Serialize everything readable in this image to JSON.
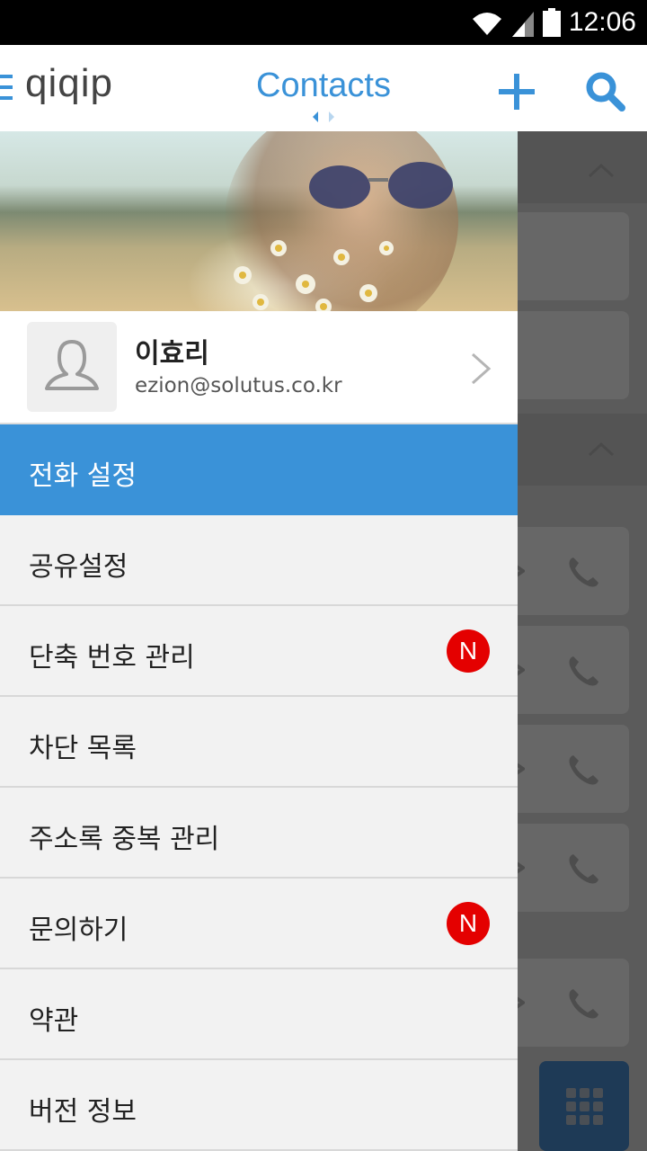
{
  "status_bar": {
    "time": "12:06"
  },
  "app_bar": {
    "logo": "qiqip",
    "title": "Contacts"
  },
  "profile": {
    "name": "이효리",
    "email": "ezion@solutus.co.kr"
  },
  "menu": [
    {
      "label": "전화 설정",
      "active": true,
      "badge": ""
    },
    {
      "label": "공유설정",
      "active": false,
      "badge": ""
    },
    {
      "label": "단축 번호 관리",
      "active": false,
      "badge": "N"
    },
    {
      "label": "차단 목록",
      "active": false,
      "badge": ""
    },
    {
      "label": "주소록 중복 관리",
      "active": false,
      "badge": ""
    },
    {
      "label": "문의하기",
      "active": false,
      "badge": "N"
    },
    {
      "label": "약관",
      "active": false,
      "badge": ""
    },
    {
      "label": "버전 정보",
      "active": false,
      "badge": ""
    }
  ],
  "colors": {
    "accent": "#3a92d8",
    "badge": "#e40000",
    "menu_bg": "#f2f2f2"
  },
  "icons": [
    "wifi-icon",
    "signal-icon",
    "battery-icon",
    "hamburger-icon",
    "plus-icon",
    "search-icon",
    "avatar-placeholder-icon",
    "chevron-right-icon",
    "chevron-up-icon",
    "phone-icon",
    "envelope-icon",
    "dialpad-icon"
  ]
}
